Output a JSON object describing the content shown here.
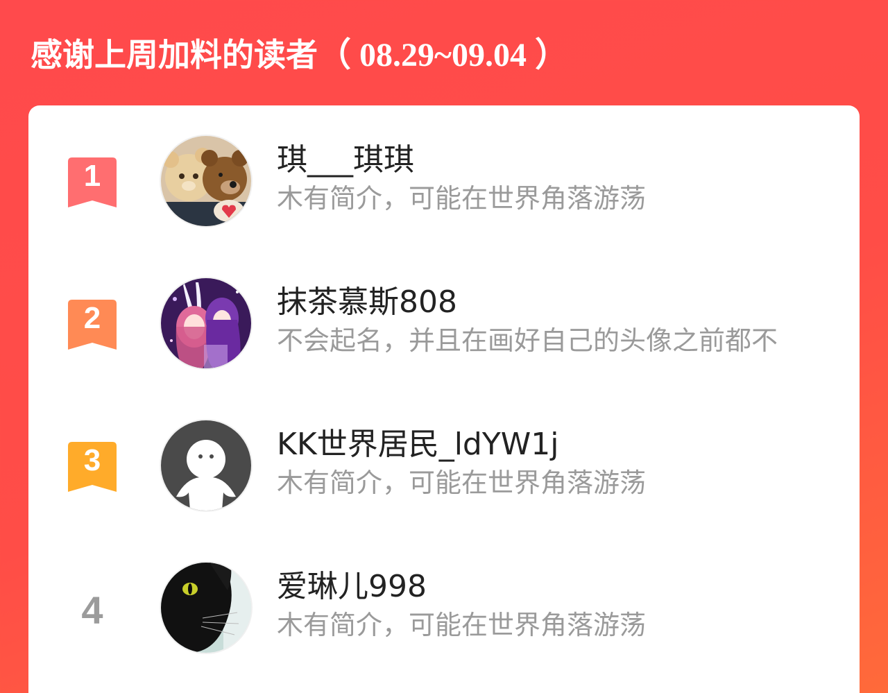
{
  "header": {
    "title": "感谢上周加料的读者",
    "date_range": "（ 08.29~09.04 ）"
  },
  "colors": {
    "background": "#ff4d47",
    "rank1": "#ff6e70",
    "rank2": "#ff8a55",
    "rank3": "#ffab2a",
    "rank_other": "#9b9b9b"
  },
  "readers": [
    {
      "rank": "1",
      "name": "琪___琪琪",
      "bio": "木有简介，可能在世界角落游荡",
      "avatar": "teddy-bears-avatar"
    },
    {
      "rank": "2",
      "name": "抹茶慕斯808",
      "bio": "不会起名，并且在画好自己的头像之前都不",
      "avatar": "anime-characters-avatar"
    },
    {
      "rank": "3",
      "name": "KK世界居民_ldYW1j",
      "bio": "木有简介，可能在世界角落游荡",
      "avatar": "default-user-avatar"
    },
    {
      "rank": "4",
      "name": "爱琳儿998",
      "bio": "木有简介，可能在世界角落游荡",
      "avatar": "black-cat-avatar"
    }
  ]
}
